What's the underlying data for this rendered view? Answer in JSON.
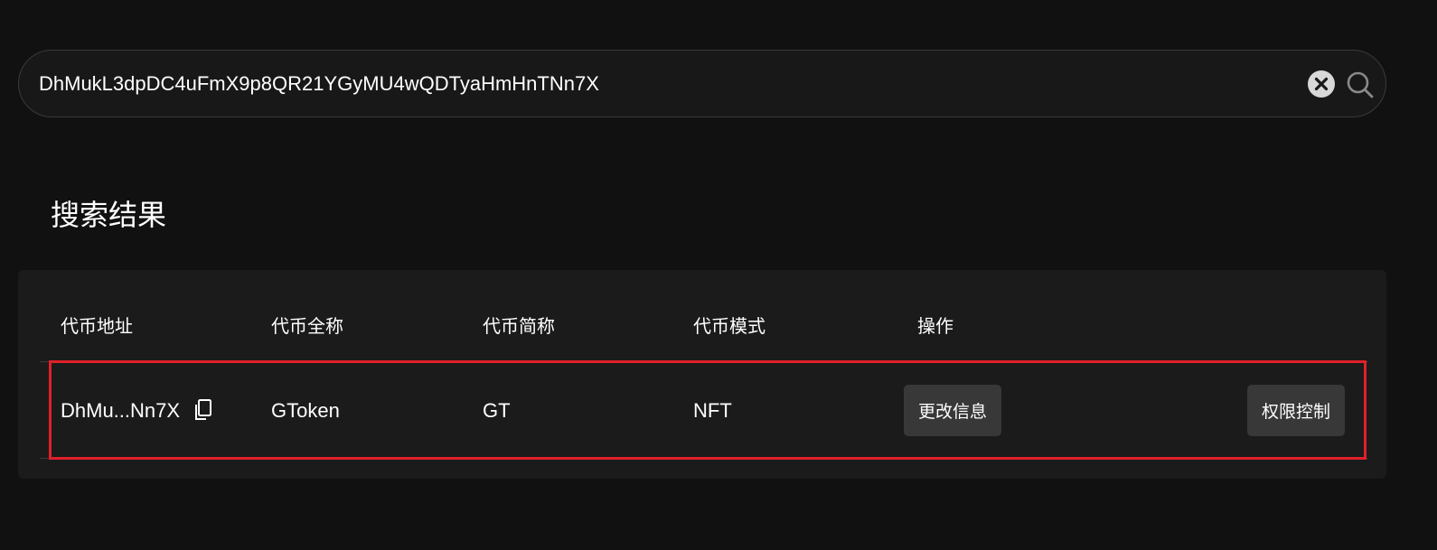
{
  "search": {
    "value": "DhMukL3dpDC4uFmX9p8QR21YGyMU4wQDTyaHmHnTNn7X",
    "clear_icon": "close-circle-icon",
    "search_icon": "search-icon"
  },
  "results": {
    "title": "搜索结果",
    "columns": [
      "代币地址",
      "代币全称",
      "代币简称",
      "代币模式",
      "操作"
    ],
    "rows": [
      {
        "address": "DhMu...Nn7X",
        "copy_icon": "copy-icon",
        "full_name": "GToken",
        "symbol": "GT",
        "mode": "NFT",
        "actions": [
          "更改信息",
          "权限控制"
        ]
      }
    ]
  },
  "colors": {
    "background": "#111111",
    "card": "#1b1b1b",
    "button": "#383838",
    "highlight": "#e0202a"
  }
}
